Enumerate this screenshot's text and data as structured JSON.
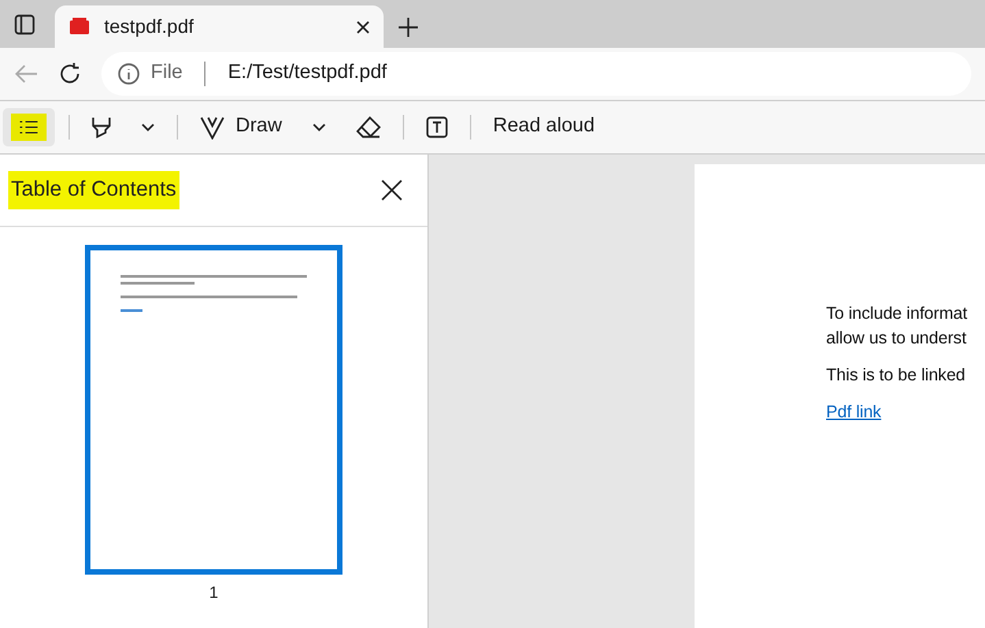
{
  "tabs": [
    {
      "title": "testpdf.pdf",
      "selected": true
    }
  ],
  "address": {
    "scheme": "File",
    "url": "E:/Test/testpdf.pdf"
  },
  "toolbar": [
    {
      "kind": "contents",
      "selected": true
    },
    {
      "kind": "highlight",
      "selected": false
    },
    {
      "kind": "draw",
      "label": "Draw",
      "selected": false
    },
    {
      "kind": "eraser",
      "selected": false
    },
    {
      "kind": "textbox",
      "selected": false
    },
    {
      "kind": "read",
      "label": "Read aloud",
      "selected": false
    }
  ],
  "sidebar": {
    "title": "Table of Contents",
    "pages": [
      {
        "number": "1",
        "selected": true
      }
    ]
  },
  "document": {
    "paragraphs": [
      "To include informat\nallow us to underst",
      "This is to be linked"
    ],
    "link": "Pdf link"
  }
}
